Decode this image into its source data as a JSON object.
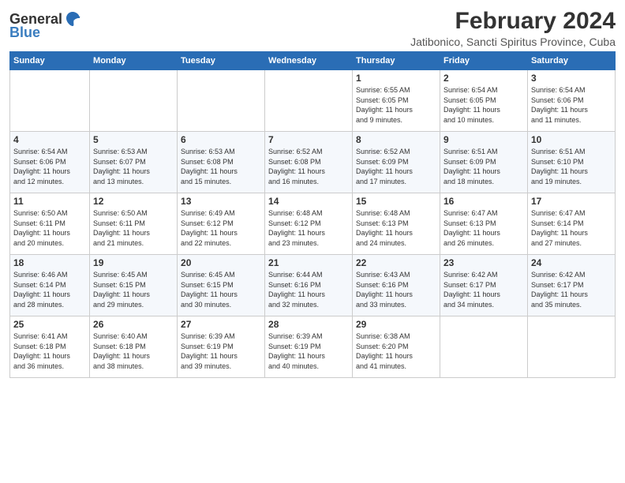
{
  "header": {
    "logo_general": "General",
    "logo_blue": "Blue",
    "title": "February 2024",
    "subtitle": "Jatibonico, Sancti Spiritus Province, Cuba"
  },
  "columns": [
    "Sunday",
    "Monday",
    "Tuesday",
    "Wednesday",
    "Thursday",
    "Friday",
    "Saturday"
  ],
  "weeks": [
    [
      {
        "day": "",
        "info": ""
      },
      {
        "day": "",
        "info": ""
      },
      {
        "day": "",
        "info": ""
      },
      {
        "day": "",
        "info": ""
      },
      {
        "day": "1",
        "info": "Sunrise: 6:55 AM\nSunset: 6:05 PM\nDaylight: 11 hours\nand 9 minutes."
      },
      {
        "day": "2",
        "info": "Sunrise: 6:54 AM\nSunset: 6:05 PM\nDaylight: 11 hours\nand 10 minutes."
      },
      {
        "day": "3",
        "info": "Sunrise: 6:54 AM\nSunset: 6:06 PM\nDaylight: 11 hours\nand 11 minutes."
      }
    ],
    [
      {
        "day": "4",
        "info": "Sunrise: 6:54 AM\nSunset: 6:06 PM\nDaylight: 11 hours\nand 12 minutes."
      },
      {
        "day": "5",
        "info": "Sunrise: 6:53 AM\nSunset: 6:07 PM\nDaylight: 11 hours\nand 13 minutes."
      },
      {
        "day": "6",
        "info": "Sunrise: 6:53 AM\nSunset: 6:08 PM\nDaylight: 11 hours\nand 15 minutes."
      },
      {
        "day": "7",
        "info": "Sunrise: 6:52 AM\nSunset: 6:08 PM\nDaylight: 11 hours\nand 16 minutes."
      },
      {
        "day": "8",
        "info": "Sunrise: 6:52 AM\nSunset: 6:09 PM\nDaylight: 11 hours\nand 17 minutes."
      },
      {
        "day": "9",
        "info": "Sunrise: 6:51 AM\nSunset: 6:09 PM\nDaylight: 11 hours\nand 18 minutes."
      },
      {
        "day": "10",
        "info": "Sunrise: 6:51 AM\nSunset: 6:10 PM\nDaylight: 11 hours\nand 19 minutes."
      }
    ],
    [
      {
        "day": "11",
        "info": "Sunrise: 6:50 AM\nSunset: 6:11 PM\nDaylight: 11 hours\nand 20 minutes."
      },
      {
        "day": "12",
        "info": "Sunrise: 6:50 AM\nSunset: 6:11 PM\nDaylight: 11 hours\nand 21 minutes."
      },
      {
        "day": "13",
        "info": "Sunrise: 6:49 AM\nSunset: 6:12 PM\nDaylight: 11 hours\nand 22 minutes."
      },
      {
        "day": "14",
        "info": "Sunrise: 6:48 AM\nSunset: 6:12 PM\nDaylight: 11 hours\nand 23 minutes."
      },
      {
        "day": "15",
        "info": "Sunrise: 6:48 AM\nSunset: 6:13 PM\nDaylight: 11 hours\nand 24 minutes."
      },
      {
        "day": "16",
        "info": "Sunrise: 6:47 AM\nSunset: 6:13 PM\nDaylight: 11 hours\nand 26 minutes."
      },
      {
        "day": "17",
        "info": "Sunrise: 6:47 AM\nSunset: 6:14 PM\nDaylight: 11 hours\nand 27 minutes."
      }
    ],
    [
      {
        "day": "18",
        "info": "Sunrise: 6:46 AM\nSunset: 6:14 PM\nDaylight: 11 hours\nand 28 minutes."
      },
      {
        "day": "19",
        "info": "Sunrise: 6:45 AM\nSunset: 6:15 PM\nDaylight: 11 hours\nand 29 minutes."
      },
      {
        "day": "20",
        "info": "Sunrise: 6:45 AM\nSunset: 6:15 PM\nDaylight: 11 hours\nand 30 minutes."
      },
      {
        "day": "21",
        "info": "Sunrise: 6:44 AM\nSunset: 6:16 PM\nDaylight: 11 hours\nand 32 minutes."
      },
      {
        "day": "22",
        "info": "Sunrise: 6:43 AM\nSunset: 6:16 PM\nDaylight: 11 hours\nand 33 minutes."
      },
      {
        "day": "23",
        "info": "Sunrise: 6:42 AM\nSunset: 6:17 PM\nDaylight: 11 hours\nand 34 minutes."
      },
      {
        "day": "24",
        "info": "Sunrise: 6:42 AM\nSunset: 6:17 PM\nDaylight: 11 hours\nand 35 minutes."
      }
    ],
    [
      {
        "day": "25",
        "info": "Sunrise: 6:41 AM\nSunset: 6:18 PM\nDaylight: 11 hours\nand 36 minutes."
      },
      {
        "day": "26",
        "info": "Sunrise: 6:40 AM\nSunset: 6:18 PM\nDaylight: 11 hours\nand 38 minutes."
      },
      {
        "day": "27",
        "info": "Sunrise: 6:39 AM\nSunset: 6:19 PM\nDaylight: 11 hours\nand 39 minutes."
      },
      {
        "day": "28",
        "info": "Sunrise: 6:39 AM\nSunset: 6:19 PM\nDaylight: 11 hours\nand 40 minutes."
      },
      {
        "day": "29",
        "info": "Sunrise: 6:38 AM\nSunset: 6:20 PM\nDaylight: 11 hours\nand 41 minutes."
      },
      {
        "day": "",
        "info": ""
      },
      {
        "day": "",
        "info": ""
      }
    ]
  ]
}
